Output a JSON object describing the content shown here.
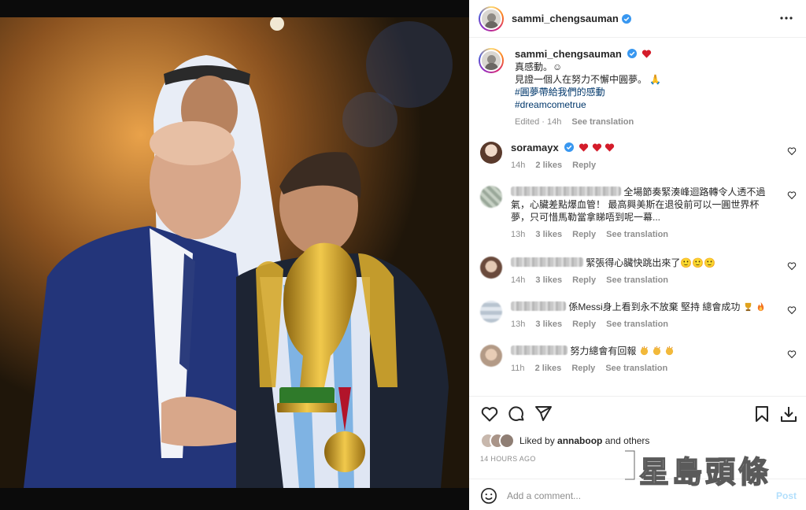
{
  "post": {
    "username": "sammi_chengsauman",
    "caption_line1": "真感動。☺",
    "caption_line2": "見證一個人在努力不懈中圓夢。 🙏",
    "hashtag1": "#圓夢帶給我們的感動",
    "hashtag2": "#dreamcometrue",
    "edited": "Edited · 14h",
    "see_translation": "See translation"
  },
  "comments": [
    {
      "user": "soramayx",
      "text": "",
      "time": "14h",
      "likes": "2 likes",
      "reply": "Reply",
      "translate": ""
    },
    {
      "user": "",
      "text": "全場節奏緊湊峰迴路轉令人透不過氣，心臟差點爆血管！ 最高興美斯在退役前可以一圓世界杯夢，只可惜馬勒當拿睇唔到呢一幕...",
      "time": "13h",
      "likes": "3 likes",
      "reply": "Reply",
      "translate": "See translation"
    },
    {
      "user": "",
      "text": "緊張得心臟快跳出來了🙂🙂🙂",
      "time": "14h",
      "likes": "3 likes",
      "reply": "Reply",
      "translate": "See translation"
    },
    {
      "user": "",
      "text": "係Messi身上看到永不放棄 堅持 總會成功",
      "time": "13h",
      "likes": "3 likes",
      "reply": "Reply",
      "translate": "See translation"
    },
    {
      "user": "",
      "text": "努力總會有回報",
      "time": "11h",
      "likes": "2 likes",
      "reply": "Reply",
      "translate": "See translation"
    }
  ],
  "liked_by": {
    "prefix": "Liked by",
    "user": "annaboop",
    "suffix": "and others"
  },
  "timestamp": "14 HOURS AGO",
  "add_comment": {
    "placeholder": "Add a comment...",
    "post_label": "Post"
  },
  "watermark": "星島頭條",
  "colors": {
    "verified": "#3897f0",
    "heart": "#ed4956",
    "link": "#00376b",
    "post_disabled": "#b2dffc"
  }
}
